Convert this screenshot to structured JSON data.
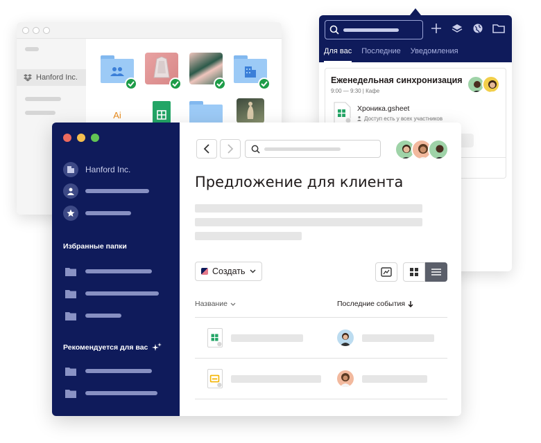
{
  "back_window": {
    "workspace_label": "Hanford Inc.",
    "ai_file_label": "Ai"
  },
  "notifications": {
    "tabs": [
      {
        "label": "Для вас",
        "active": true
      },
      {
        "label": "Последние",
        "active": false
      },
      {
        "label": "Уведомления",
        "active": false
      }
    ],
    "event": {
      "title": "Еженедельная синхронизация",
      "meta": "9:00 — 9:30 | Кафе",
      "file_name": "Хроника.gsheet",
      "file_access": "Доступ есть у всех участников"
    }
  },
  "sidebar": {
    "workspace": "Hanford Inc.",
    "favorites_heading": "Избранные папки",
    "recommended_heading": "Рекомендуется для вас"
  },
  "main": {
    "page_title": "Предложение для клиента",
    "create_label": "Создать",
    "columns": {
      "name": "Название",
      "activity": "Последние события"
    }
  },
  "colors": {
    "navy": "#0f1b5b",
    "success_green": "#1d9c48",
    "folder_blue": "#9ccaf6"
  }
}
